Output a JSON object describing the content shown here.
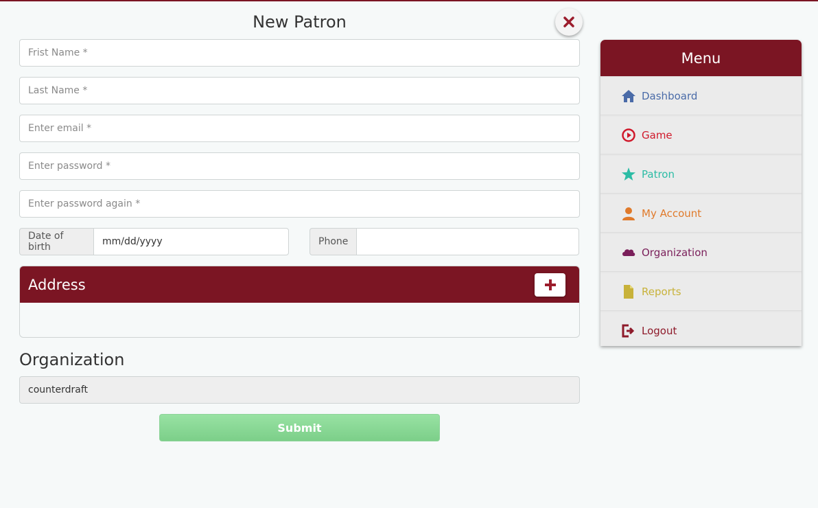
{
  "page": {
    "title": "New Patron",
    "close_label": "close"
  },
  "form": {
    "first_name_placeholder": "Frist Name *",
    "last_name_placeholder": "Last Name *",
    "email_placeholder": "Enter email *",
    "password_placeholder": "Enter password *",
    "password_again_placeholder": "Enter password again *",
    "dob_label": "Date of birth",
    "dob_placeholder": "mm/dd/yyyy",
    "phone_label": "Phone",
    "phone_value": ""
  },
  "address": {
    "heading": "Address"
  },
  "organization": {
    "heading": "Organization",
    "value": "counterdraft"
  },
  "submit_label": "Submit",
  "menu": {
    "title": "Menu",
    "items": [
      {
        "label": "Dashboard",
        "icon": "home-icon",
        "color": "#4a6ba8"
      },
      {
        "label": "Game",
        "icon": "play-circle-icon",
        "color": "#d0192b"
      },
      {
        "label": "Patron",
        "icon": "star-icon",
        "color": "#2cbca5"
      },
      {
        "label": "My Account",
        "icon": "user-icon",
        "color": "#e07a2b"
      },
      {
        "label": "Organization",
        "icon": "cloud-icon",
        "color": "#7a1f5a"
      },
      {
        "label": "Reports",
        "icon": "file-icon",
        "color": "#c8b23a"
      },
      {
        "label": "Logout",
        "icon": "logout-icon",
        "color": "#8e1a2a"
      }
    ]
  },
  "colors": {
    "brand": "#7b1523",
    "submit": "#8ed39a"
  }
}
